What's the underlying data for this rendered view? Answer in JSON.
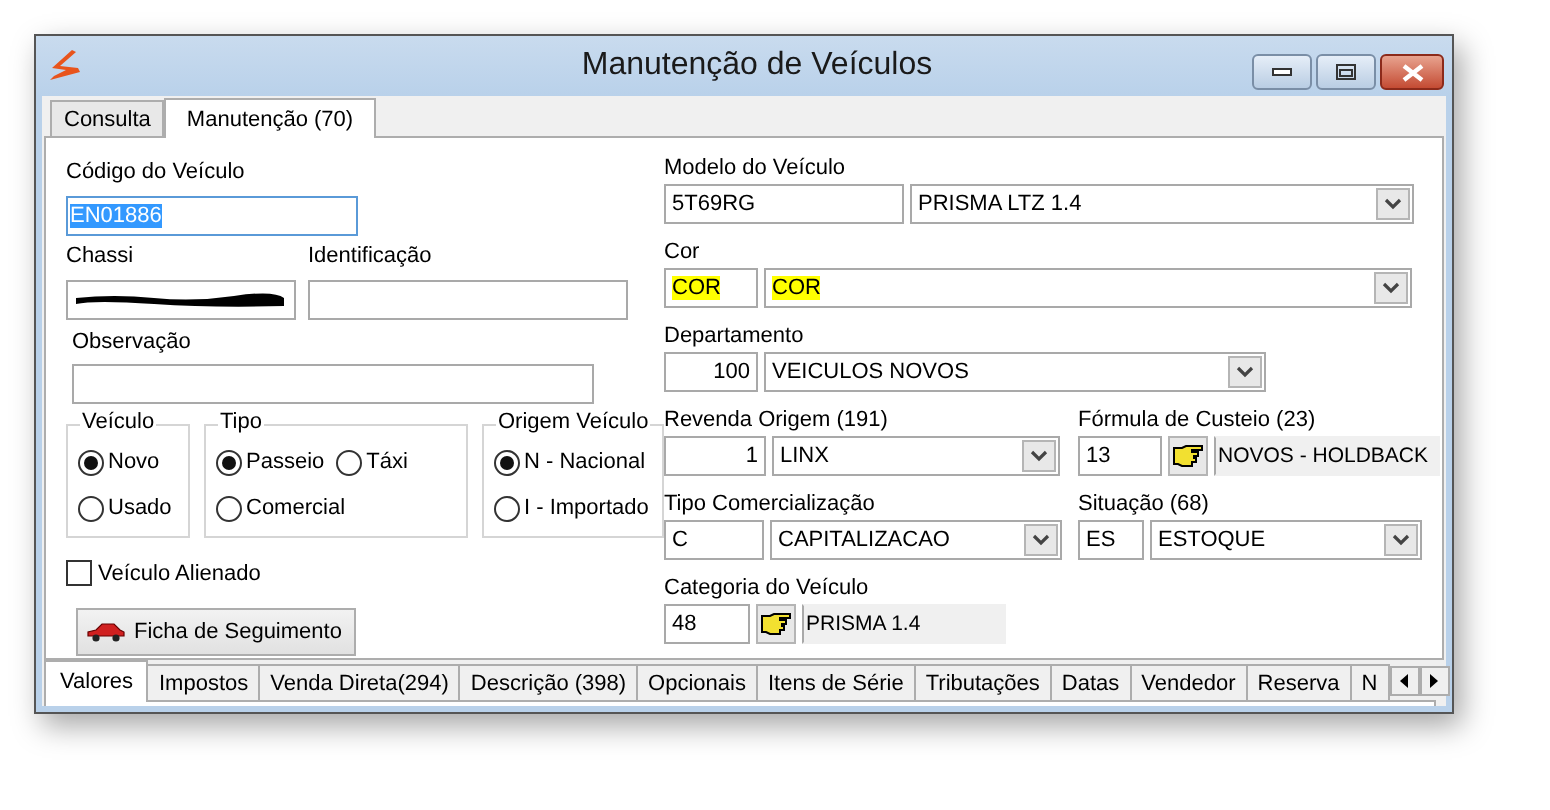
{
  "window": {
    "title": "Manutenção de Veículos"
  },
  "tabs": [
    {
      "label": "Consulta",
      "selected": false
    },
    {
      "label": "Manutenção (70)",
      "selected": true
    }
  ],
  "codigo": {
    "label": "Código do Veículo",
    "value": "EN01886",
    "text_selected": true
  },
  "chassi": {
    "label": "Chassi",
    "redacted": true
  },
  "identificacao": {
    "label": "Identificação"
  },
  "observacao": {
    "label": "Observação"
  },
  "groups": [
    {
      "title": "Veículo",
      "options": [
        {
          "label": "Novo",
          "selected": true
        },
        {
          "label": "Usado",
          "selected": false
        }
      ]
    },
    {
      "title": "Tipo",
      "options": [
        {
          "label": "Passeio",
          "selected": true
        },
        {
          "label": "Táxi",
          "selected": false
        },
        {
          "label": "Comercial",
          "selected": false
        }
      ]
    },
    {
      "title": "Origem Veículo",
      "options": [
        {
          "label": "N - Nacional",
          "selected": true
        },
        {
          "label": "I - Importado",
          "selected": false
        }
      ]
    }
  ],
  "alienado": {
    "label": "Veículo Alienado",
    "checked": false
  },
  "ficha_button": {
    "label": "Ficha de Seguimento"
  },
  "rows": [
    [
      {
        "label": "Modelo do Veículo",
        "parts": [
          {
            "kind": "code",
            "value": "5T69RG"
          },
          {
            "kind": "combo",
            "value": "PRISMA LTZ 1.4"
          }
        ]
      }
    ],
    [
      {
        "label": "Cor",
        "parts": [
          {
            "kind": "code",
            "value": "COR",
            "highlighted": true
          },
          {
            "kind": "combo",
            "value": "COR",
            "highlighted": true
          }
        ]
      }
    ],
    [
      {
        "label": "Departamento",
        "parts": [
          {
            "kind": "number",
            "value": "100"
          },
          {
            "kind": "combo",
            "value": "VEICULOS NOVOS"
          }
        ]
      }
    ],
    [
      {
        "label": "Revenda Origem (191)",
        "parts": [
          {
            "kind": "number",
            "value": "1"
          },
          {
            "kind": "combo",
            "value": "LINX"
          }
        ]
      },
      {
        "label": "Fórmula de Custeio (23)",
        "parts": [
          {
            "kind": "code",
            "value": "13"
          },
          {
            "kind": "pointer"
          },
          {
            "kind": "readonly",
            "value": "NOVOS - HOLDBACK"
          }
        ]
      }
    ],
    [
      {
        "label": "Tipo Comercialização",
        "parts": [
          {
            "kind": "code",
            "value": "C"
          },
          {
            "kind": "combo",
            "value": "CAPITALIZACAO"
          }
        ]
      },
      {
        "label": "Situação (68)",
        "parts": [
          {
            "kind": "code",
            "value": "ES"
          },
          {
            "kind": "combo",
            "value": "ESTOQUE"
          }
        ]
      }
    ],
    [
      {
        "label": "Categoria do Veículo",
        "parts": [
          {
            "kind": "code",
            "value": "48"
          },
          {
            "kind": "pointer"
          },
          {
            "kind": "readonly",
            "value": "PRISMA 1.4"
          }
        ]
      }
    ]
  ],
  "bottom_tabs": [
    {
      "label": "Valores",
      "selected": true
    },
    {
      "label": "Impostos",
      "selected": false
    },
    {
      "label": "Venda Direta(294)",
      "selected": false
    },
    {
      "label": "Descrição (398)",
      "selected": false
    },
    {
      "label": "Opcionais",
      "selected": false
    },
    {
      "label": "Itens de Série",
      "selected": false
    },
    {
      "label": "Tributações",
      "selected": false
    },
    {
      "label": "Datas",
      "selected": false
    },
    {
      "label": "Vendedor",
      "selected": false
    },
    {
      "label": "Reserva",
      "selected": false
    },
    {
      "label": "N",
      "selected": false
    }
  ]
}
